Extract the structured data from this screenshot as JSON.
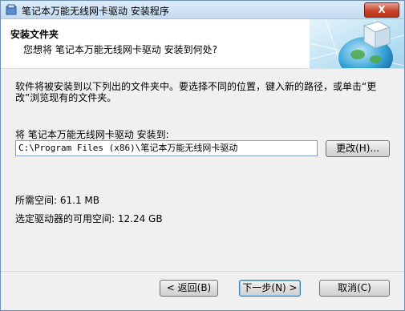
{
  "window": {
    "title": "笔记本万能无线网卡驱动 安装程序",
    "close_label": "X"
  },
  "header": {
    "title": "安装文件夹",
    "subtitle": "您想将 笔记本万能无线网卡驱动 安装到何处?"
  },
  "body": {
    "description": "软件将被安装到以下列出的文件夹中。要选择不同的位置，键入新的路径，或单击“更改”浏览现有的文件夹。",
    "install_label": "将 笔记本万能无线网卡驱动 安装到:",
    "path_value": "C:\\Program Files (x86)\\笔记本万能无线网卡驱动",
    "browse_label": "更改(H)...",
    "space_required": "所需空间: 61.1 MB",
    "space_available": "选定驱动器的可用空间: 12.24 GB"
  },
  "footer": {
    "back_label": "< 返回(B)",
    "next_label": "下一步(N) >",
    "cancel_label": "取消(C)"
  },
  "icons": {
    "app": "installer-icon",
    "header": "network-globe-cube-icon"
  }
}
